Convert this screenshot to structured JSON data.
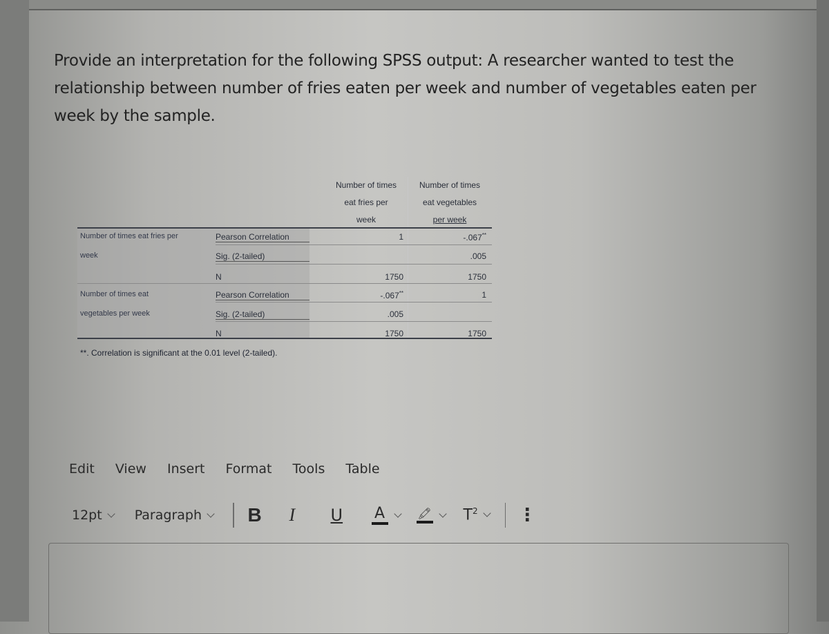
{
  "question": {
    "text": "Provide an interpretation for the following SPSS output: A researcher wanted to test the relationship between number of fries eaten per week and number of vegetables eaten per week by the sample."
  },
  "spss_table": {
    "column_headers": [
      "Number of times eat fries per week",
      "Number of times eat vegetables per week"
    ],
    "column_header_lines": [
      [
        "Number of times",
        "eat fries per",
        "week"
      ],
      [
        "Number of times",
        "eat vegetables",
        "per week"
      ]
    ],
    "groups": [
      {
        "variable_lines": [
          "Number of times eat fries per",
          "week"
        ],
        "rows": [
          {
            "stat": "Pearson Correlation",
            "c1": "1",
            "c2": "-.067",
            "c2_sup": "**"
          },
          {
            "stat": "Sig. (2-tailed)",
            "c1": "",
            "c2": ".005"
          },
          {
            "stat": "N",
            "c1": "1750",
            "c2": "1750"
          }
        ]
      },
      {
        "variable_lines": [
          "Number of times eat",
          "vegetables per week"
        ],
        "rows": [
          {
            "stat": "Pearson Correlation",
            "c1": "-.067",
            "c1_sup": "**",
            "c2": "1"
          },
          {
            "stat": "Sig. (2-tailed)",
            "c1": ".005",
            "c2": ""
          },
          {
            "stat": "N",
            "c1": "1750",
            "c2": "1750"
          }
        ]
      }
    ],
    "footnote": "**. Correlation is significant at the 0.01 level (2-tailed)."
  },
  "editor": {
    "menu": [
      "Edit",
      "View",
      "Insert",
      "Format",
      "Tools",
      "Table"
    ],
    "font_size": "12pt",
    "block_format": "Paragraph",
    "buttons": {
      "bold": "B",
      "italic": "I",
      "underline": "U",
      "text_color": "A",
      "highlight": "🖍",
      "superscript": "T",
      "superscript_sup": "2",
      "more": "⋮"
    },
    "content": ""
  }
}
